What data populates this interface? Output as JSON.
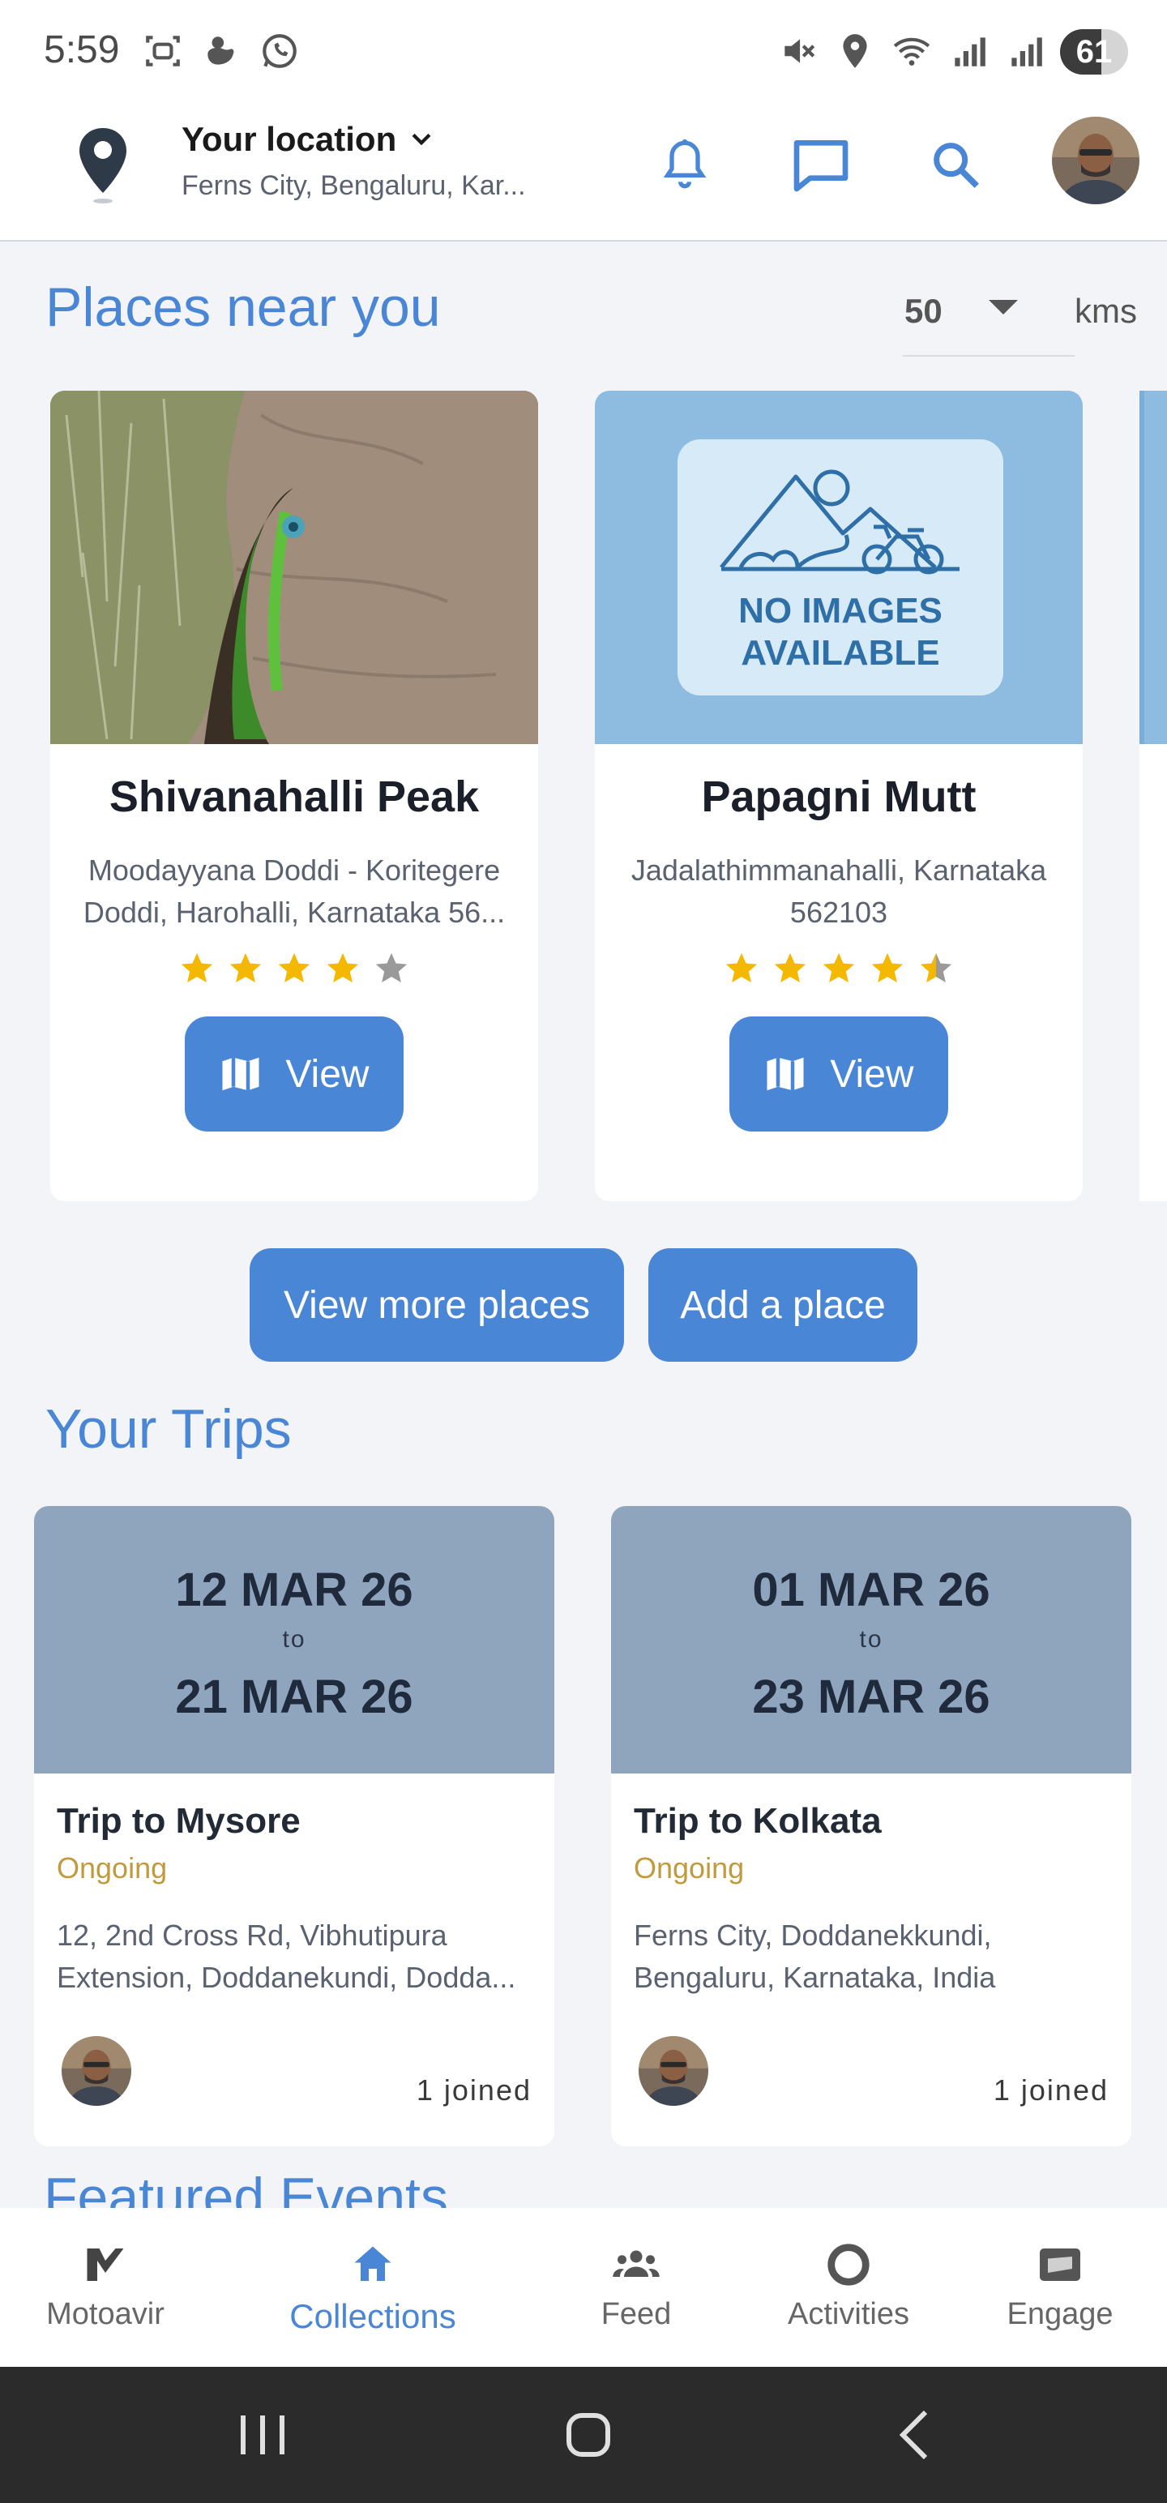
{
  "status_bar": {
    "time": "5:59",
    "battery": "61",
    "battery_level": 0.61
  },
  "header": {
    "location_title": "Your location",
    "location_subtitle": "Ferns City, Bengaluru, Kar..."
  },
  "places": {
    "title": "Places near you",
    "distance_value": "50",
    "distance_unit": "kms",
    "cards": [
      {
        "name": "Shivanahalli Peak",
        "address": "Moodayyana Doddi - Koritegere Doddi, Harohalli, Karnataka 56...",
        "rating": 4,
        "view_label": "View"
      },
      {
        "name": "Papagni Mutt",
        "address": "Jadalathimmanahalli, Karnataka 562103",
        "rating": 4.5,
        "view_label": "View",
        "no_image_text_1": "NO IMAGES",
        "no_image_text_2": "AVAILABLE"
      }
    ],
    "view_more_label": "View more places",
    "add_place_label": "Add a place"
  },
  "trips": {
    "title": "Your Trips",
    "items": [
      {
        "start": "12 MAR 26",
        "to": "to",
        "end": "21 MAR 26",
        "name": "Trip to Mysore",
        "status": "Ongoing",
        "address": "12, 2nd Cross Rd, Vibhutipura Extension, Doddanekundi, Dodda...",
        "joined": "1 joined"
      },
      {
        "start": "01 MAR 26",
        "to": "to",
        "end": "23 MAR 26",
        "name": "Trip to Kolkata",
        "status": "Ongoing",
        "address": "Ferns City, Doddanekkundi, Bengaluru, Karnataka, India",
        "joined": "1 joined"
      }
    ]
  },
  "featured": {
    "title": "Featured Events"
  },
  "bottom_nav": {
    "items": [
      {
        "label": "Motoavir",
        "icon": "motoavir-logo-icon"
      },
      {
        "label": "Collections",
        "icon": "home-icon",
        "active": true
      },
      {
        "label": "Feed",
        "icon": "people-icon"
      },
      {
        "label": "Activities",
        "icon": "circle-icon"
      },
      {
        "label": "Engage",
        "icon": "engage-icon"
      }
    ]
  },
  "colors": {
    "accent": "#4a86d6",
    "status_ongoing": "#c19a3e",
    "star": "#f5b800"
  }
}
